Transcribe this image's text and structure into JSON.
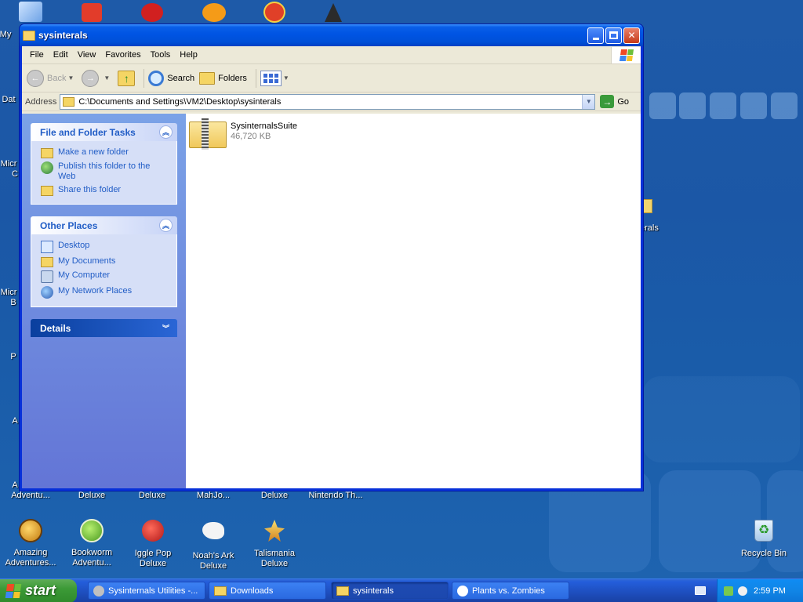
{
  "desktop": {
    "top_row_labels": [
      "My",
      "Dat",
      "Micr",
      "C",
      "Micr",
      "B",
      "P",
      "A",
      "A"
    ],
    "mid_row_labels": [
      "Adventu...",
      "Deluxe",
      "Deluxe",
      "MahJo...",
      "Deluxe",
      "Nintendo Th..."
    ],
    "right_partial_label": "erals",
    "icons": [
      {
        "name": "amazing-adventures",
        "line1": "Amazing",
        "line2": "Adventures..."
      },
      {
        "name": "bookworm-adventures",
        "line1": "Bookworm",
        "line2": "Adventu..."
      },
      {
        "name": "iggle-pop-deluxe",
        "line1": "Iggle Pop",
        "line2": "Deluxe"
      },
      {
        "name": "noahs-ark-deluxe",
        "line1": "Noah's Ark",
        "line2": "Deluxe"
      },
      {
        "name": "talismania-deluxe",
        "line1": "Talismania",
        "line2": "Deluxe"
      }
    ],
    "recycle_bin": "Recycle Bin"
  },
  "window": {
    "title": "sysinterals",
    "menu": [
      "File",
      "Edit",
      "View",
      "Favorites",
      "Tools",
      "Help"
    ],
    "toolbar": {
      "back": "Back",
      "search": "Search",
      "folders": "Folders"
    },
    "address": {
      "label": "Address",
      "value": "C:\\Documents and Settings\\VM2\\Desktop\\sysinterals",
      "go": "Go"
    },
    "file_folder_tasks": {
      "title": "File and Folder Tasks",
      "items": [
        "Make a new folder",
        "Publish this folder to the Web",
        "Share this folder"
      ]
    },
    "other_places": {
      "title": "Other Places",
      "items": [
        "Desktop",
        "My Documents",
        "My Computer",
        "My Network Places"
      ]
    },
    "details": {
      "title": "Details"
    },
    "files": [
      {
        "name": "SysinternalsSuite",
        "size": "46,720 KB"
      }
    ]
  },
  "taskbar": {
    "start": "start",
    "buttons": [
      {
        "label": "Sysinternals Utilities -...",
        "active": false
      },
      {
        "label": "Downloads",
        "active": false
      },
      {
        "label": "sysinterals",
        "active": true
      },
      {
        "label": "Plants vs. Zombies",
        "active": false
      }
    ],
    "clock": "2:59 PM"
  },
  "colors": {
    "desktop": "#1b57a6",
    "title_bar": "#0054e3",
    "task_link": "#215dc6",
    "start_green": "#3c9a37"
  }
}
